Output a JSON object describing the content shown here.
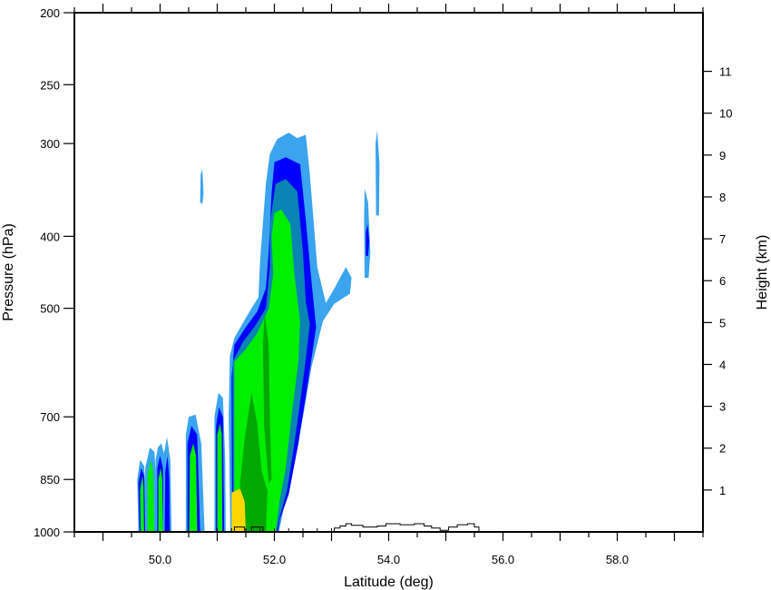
{
  "chart_data": {
    "type": "contour",
    "xlabel": "Latitude (deg)",
    "ylabel_left": "Pressure (hPa)",
    "ylabel_right": "Height (km)",
    "x_range": [
      48.5,
      59.5
    ],
    "x_ticks": [
      {
        "value": 50,
        "label": "50.0"
      },
      {
        "value": 52,
        "label": "52.0"
      },
      {
        "value": 54,
        "label": "54.0"
      },
      {
        "value": 56,
        "label": "56.0"
      },
      {
        "value": 58,
        "label": "58.0"
      }
    ],
    "x_minor_step": 0.5,
    "y_scale": "log-pressure",
    "y_range_hpa": [
      1000,
      200
    ],
    "y_ticks": [
      {
        "value": 1000,
        "label": "1000"
      },
      {
        "value": 850,
        "label": "850"
      },
      {
        "value": 700,
        "label": "700"
      },
      {
        "value": 500,
        "label": "500"
      },
      {
        "value": 400,
        "label": "400"
      },
      {
        "value": 300,
        "label": "300"
      },
      {
        "value": 250,
        "label": "250"
      },
      {
        "value": 200,
        "label": "200"
      }
    ],
    "right_ticks": [
      {
        "value": 1,
        "label": "1"
      },
      {
        "value": 2,
        "label": "2"
      },
      {
        "value": 3,
        "label": "3"
      },
      {
        "value": 4,
        "label": "4"
      },
      {
        "value": 5,
        "label": "5"
      },
      {
        "value": 6,
        "label": "6"
      },
      {
        "value": 7,
        "label": "7"
      },
      {
        "value": 8,
        "label": "8"
      },
      {
        "value": 9,
        "label": "9"
      },
      {
        "value": 10,
        "label": "10"
      },
      {
        "value": 11,
        "label": "11"
      }
    ],
    "shading_levels": [
      {
        "level": 1,
        "color": "#3aa4ee"
      },
      {
        "level": 2,
        "color": "#0000ff"
      },
      {
        "level": 3,
        "color": "#0a84b4"
      },
      {
        "level": 4,
        "color": "#00ee00"
      },
      {
        "level": 5,
        "color": "#00a800"
      },
      {
        "level": 6,
        "color": "#ffd700"
      }
    ],
    "regions": [
      {
        "level": 1,
        "points": [
          [
            51.23,
            1000
          ],
          [
            51.2,
            700
          ],
          [
            51.22,
            580
          ],
          [
            51.3,
            548
          ],
          [
            51.45,
            523
          ],
          [
            51.58,
            503
          ],
          [
            51.72,
            483
          ],
          [
            51.75,
            430
          ],
          [
            51.85,
            340
          ],
          [
            51.92,
            310
          ],
          [
            52.05,
            296
          ],
          [
            52.25,
            290
          ],
          [
            52.4,
            295
          ],
          [
            52.55,
            292
          ],
          [
            52.62,
            330
          ],
          [
            52.75,
            440
          ],
          [
            52.9,
            492
          ],
          [
            53.05,
            470
          ],
          [
            53.25,
            440
          ],
          [
            53.35,
            455
          ],
          [
            53.32,
            478
          ],
          [
            53.05,
            493
          ],
          [
            52.85,
            520
          ],
          [
            52.65,
            600
          ],
          [
            52.5,
            700
          ],
          [
            52.35,
            800
          ],
          [
            52.2,
            900
          ],
          [
            52.08,
            1000
          ]
        ]
      },
      {
        "level": 2,
        "points": [
          [
            51.26,
            1000
          ],
          [
            51.25,
            620
          ],
          [
            51.3,
            560
          ],
          [
            51.5,
            530
          ],
          [
            51.7,
            505
          ],
          [
            51.85,
            470
          ],
          [
            51.9,
            420
          ],
          [
            51.95,
            350
          ],
          [
            52.0,
            318
          ],
          [
            52.2,
            313
          ],
          [
            52.45,
            320
          ],
          [
            52.55,
            380
          ],
          [
            52.65,
            460
          ],
          [
            52.73,
            530
          ],
          [
            52.6,
            620
          ],
          [
            52.42,
            760
          ],
          [
            52.25,
            890
          ],
          [
            52.1,
            960
          ],
          [
            52.06,
            1000
          ]
        ]
      },
      {
        "level": 3,
        "points": [
          [
            51.28,
            1000
          ],
          [
            51.27,
            590
          ],
          [
            51.45,
            555
          ],
          [
            51.65,
            530
          ],
          [
            51.85,
            500
          ],
          [
            51.92,
            440
          ],
          [
            51.92,
            385
          ],
          [
            52.02,
            340
          ],
          [
            52.2,
            335
          ],
          [
            52.4,
            348
          ],
          [
            52.5,
            420
          ],
          [
            52.55,
            490
          ],
          [
            52.62,
            525
          ],
          [
            52.52,
            610
          ],
          [
            52.35,
            760
          ],
          [
            52.22,
            880
          ],
          [
            52.1,
            950
          ],
          [
            52.04,
            1000
          ]
        ]
      },
      {
        "level": 4,
        "points": [
          [
            51.3,
            1000
          ],
          [
            51.3,
            590
          ],
          [
            51.48,
            570
          ],
          [
            51.7,
            540
          ],
          [
            51.9,
            500
          ],
          [
            51.98,
            450
          ],
          [
            51.95,
            400
          ],
          [
            52.0,
            372
          ],
          [
            52.12,
            368
          ],
          [
            52.28,
            385
          ],
          [
            52.35,
            450
          ],
          [
            52.45,
            520
          ],
          [
            52.42,
            590
          ],
          [
            52.3,
            700
          ],
          [
            52.2,
            820
          ],
          [
            52.1,
            900
          ],
          [
            52.02,
            1000
          ]
        ]
      },
      {
        "level": 5,
        "points": [
          [
            51.38,
            1000
          ],
          [
            51.4,
            860
          ],
          [
            51.48,
            750
          ],
          [
            51.6,
            650
          ],
          [
            51.7,
            715
          ],
          [
            51.78,
            830
          ],
          [
            51.88,
            880
          ],
          [
            51.85,
            1000
          ]
        ]
      },
      {
        "level": 5,
        "points": [
          [
            51.9,
            860
          ],
          [
            51.82,
            720
          ],
          [
            51.8,
            560
          ],
          [
            51.83,
            508
          ],
          [
            51.9,
            560
          ],
          [
            51.92,
            700
          ],
          [
            51.95,
            850
          ]
        ]
      },
      {
        "level": 6,
        "points": [
          [
            51.25,
            1000
          ],
          [
            51.25,
            885
          ],
          [
            51.4,
            875
          ],
          [
            51.48,
            910
          ],
          [
            51.5,
            1000
          ]
        ]
      },
      {
        "level": 1,
        "points": [
          [
            49.62,
            1000
          ],
          [
            49.6,
            850
          ],
          [
            49.65,
            800
          ],
          [
            49.72,
            815
          ],
          [
            49.76,
            900
          ],
          [
            49.78,
            1000
          ]
        ]
      },
      {
        "level": 2,
        "points": [
          [
            49.64,
            1000
          ],
          [
            49.62,
            860
          ],
          [
            49.67,
            820
          ],
          [
            49.72,
            840
          ],
          [
            49.74,
            1000
          ]
        ]
      },
      {
        "level": 4,
        "points": [
          [
            49.66,
            1000
          ],
          [
            49.65,
            880
          ],
          [
            49.69,
            840
          ],
          [
            49.71,
            870
          ],
          [
            49.72,
            1000
          ]
        ]
      },
      {
        "level": 1,
        "points": [
          [
            49.74,
            1000
          ],
          [
            49.74,
            820
          ],
          [
            49.82,
            770
          ],
          [
            49.9,
            780
          ],
          [
            49.94,
            870
          ],
          [
            49.95,
            1000
          ]
        ]
      },
      {
        "level": 4,
        "points": [
          [
            49.78,
            1000
          ],
          [
            49.78,
            840
          ],
          [
            49.84,
            800
          ],
          [
            49.88,
            830
          ],
          [
            49.9,
            1000
          ]
        ]
      },
      {
        "level": 1,
        "points": [
          [
            49.93,
            1000
          ],
          [
            49.92,
            800
          ],
          [
            49.96,
            770
          ],
          [
            50.02,
            760
          ],
          [
            50.1,
            800
          ],
          [
            50.12,
            1000
          ]
        ]
      },
      {
        "level": 2,
        "points": [
          [
            49.95,
            1000
          ],
          [
            49.95,
            820
          ],
          [
            50.0,
            790
          ],
          [
            50.05,
            820
          ],
          [
            50.07,
            1000
          ]
        ]
      },
      {
        "level": 4,
        "points": [
          [
            49.97,
            1000
          ],
          [
            49.97,
            850
          ],
          [
            50.01,
            820
          ],
          [
            50.04,
            850
          ],
          [
            50.05,
            1000
          ]
        ]
      },
      {
        "level": 1,
        "points": [
          [
            50.05,
            1000
          ],
          [
            50.06,
            790
          ],
          [
            50.12,
            745
          ],
          [
            50.18,
            800
          ],
          [
            50.2,
            1000
          ]
        ]
      },
      {
        "level": 2,
        "points": [
          [
            50.08,
            1000
          ],
          [
            50.09,
            830
          ],
          [
            50.13,
            790
          ],
          [
            50.16,
            850
          ],
          [
            50.17,
            1000
          ]
        ]
      },
      {
        "level": 1,
        "points": [
          [
            50.45,
            1000
          ],
          [
            50.45,
            740
          ],
          [
            50.5,
            700
          ],
          [
            50.62,
            695
          ],
          [
            50.72,
            760
          ],
          [
            50.78,
            1000
          ]
        ]
      },
      {
        "level": 2,
        "points": [
          [
            50.48,
            1000
          ],
          [
            50.48,
            760
          ],
          [
            50.55,
            720
          ],
          [
            50.65,
            740
          ],
          [
            50.7,
            1000
          ]
        ]
      },
      {
        "level": 4,
        "points": [
          [
            50.51,
            1000
          ],
          [
            50.52,
            790
          ],
          [
            50.58,
            760
          ],
          [
            50.63,
            790
          ],
          [
            50.65,
            1000
          ]
        ]
      },
      {
        "level": 1,
        "points": [
          [
            50.95,
            1000
          ],
          [
            50.95,
            700
          ],
          [
            51.02,
            650
          ],
          [
            51.1,
            660
          ],
          [
            51.14,
            800
          ],
          [
            51.15,
            1000
          ]
        ]
      },
      {
        "level": 2,
        "points": [
          [
            50.98,
            1000
          ],
          [
            50.98,
            720
          ],
          [
            51.03,
            680
          ],
          [
            51.1,
            700
          ],
          [
            51.12,
            1000
          ]
        ]
      },
      {
        "level": 4,
        "points": [
          [
            51.0,
            1000
          ],
          [
            51.0,
            740
          ],
          [
            51.05,
            715
          ],
          [
            51.08,
            740
          ],
          [
            51.09,
            1000
          ]
        ]
      },
      {
        "level": 1,
        "points": [
          [
            50.7,
            360
          ],
          [
            50.71,
            330
          ],
          [
            50.74,
            325
          ],
          [
            50.76,
            350
          ],
          [
            50.74,
            362
          ]
        ]
      },
      {
        "level": 1,
        "points": [
          [
            53.58,
            455
          ],
          [
            53.57,
            380
          ],
          [
            53.58,
            345
          ],
          [
            53.64,
            360
          ],
          [
            53.68,
            420
          ],
          [
            53.65,
            455
          ]
        ]
      },
      {
        "level": 2,
        "points": [
          [
            53.6,
            425
          ],
          [
            53.6,
            395
          ],
          [
            53.63,
            385
          ],
          [
            53.66,
            405
          ],
          [
            53.64,
            425
          ]
        ]
      },
      {
        "level": 1,
        "points": [
          [
            53.78,
            375
          ],
          [
            53.77,
            300
          ],
          [
            53.8,
            288
          ],
          [
            53.84,
            320
          ],
          [
            53.83,
            375
          ]
        ]
      }
    ],
    "terrain_profile": [
      [
        51.3,
        1000
      ],
      [
        51.3,
        985
      ],
      [
        51.48,
        985
      ],
      [
        51.48,
        1000
      ],
      [
        51.6,
        1000
      ],
      [
        51.6,
        985
      ],
      [
        51.8,
        985
      ],
      [
        51.8,
        1000
      ],
      [
        53.05,
        1000
      ],
      [
        53.05,
        988
      ],
      [
        53.15,
        988
      ],
      [
        53.15,
        982
      ],
      [
        53.25,
        982
      ],
      [
        53.25,
        975
      ],
      [
        53.35,
        975
      ],
      [
        53.35,
        980
      ],
      [
        53.55,
        980
      ],
      [
        53.55,
        985
      ],
      [
        53.8,
        985
      ],
      [
        53.8,
        982
      ],
      [
        53.95,
        982
      ],
      [
        53.95,
        975
      ],
      [
        54.2,
        975
      ],
      [
        54.2,
        978
      ],
      [
        54.45,
        978
      ],
      [
        54.45,
        975
      ],
      [
        54.62,
        975
      ],
      [
        54.62,
        982
      ],
      [
        54.75,
        982
      ],
      [
        54.75,
        988
      ],
      [
        54.9,
        988
      ],
      [
        54.9,
        995
      ],
      [
        55.05,
        995
      ],
      [
        55.05,
        985
      ],
      [
        55.2,
        985
      ],
      [
        55.2,
        978
      ],
      [
        55.38,
        978
      ],
      [
        55.38,
        975
      ],
      [
        55.5,
        975
      ],
      [
        55.5,
        985
      ],
      [
        55.58,
        985
      ],
      [
        55.58,
        1000
      ]
    ],
    "terrain_ticks": [
      51.0,
      51.25,
      51.5,
      51.75,
      52.0,
      52.25,
      52.5,
      52.75,
      53.0
    ]
  }
}
